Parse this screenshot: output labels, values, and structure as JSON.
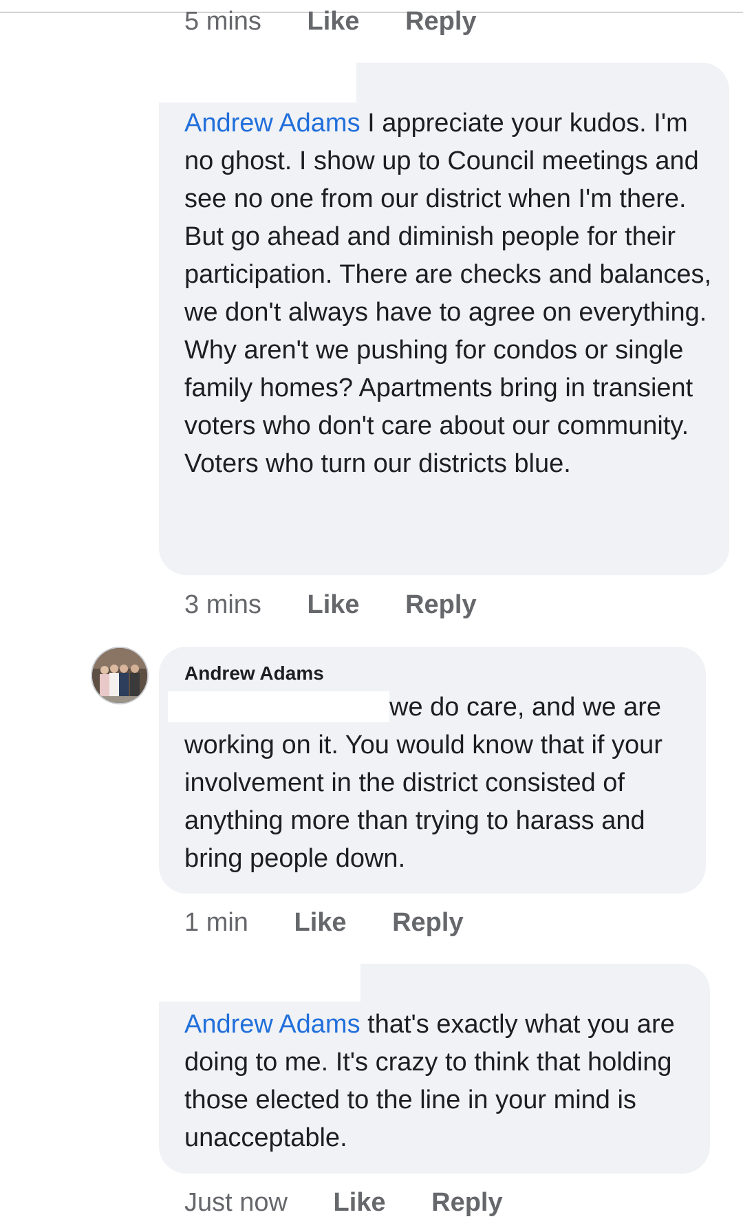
{
  "colors": {
    "bubble": "#f0f2f5",
    "mention": "#216fdb",
    "meta": "#65676b",
    "text": "#1c1e21"
  },
  "top_meta": {
    "time": "5 mins",
    "like": "Like",
    "reply": "Reply"
  },
  "comments": [
    {
      "mention": "Andrew Adams",
      "text": " I appreciate your kudos. I'm no ghost. I show up to Council meetings and see no one from our district when I'm there. But go ahead and diminish people for their participation. There are checks and balances, we don't always have to agree on everything. Why aren't we pushing for condos or single family homes? Apartments bring in transient voters who don't care about our community. Voters who turn our districts blue.",
      "time": "3 mins",
      "like": "Like",
      "reply": "Reply"
    },
    {
      "author": "Andrew Adams",
      "avatar_icon": "profile-photo-icon",
      "text": "we do care, and we are working on it. You would know that if your involvement in the district consisted of anything more than trying to harass and bring people down.",
      "time": "1 min",
      "like": "Like",
      "reply": "Reply"
    },
    {
      "mention": "Andrew Adams",
      "text": " that's exactly what you are doing to me. It's crazy to think that holding those elected to the line in your mind is unacceptable.",
      "time": "Just now",
      "like": "Like",
      "reply": "Reply"
    }
  ]
}
